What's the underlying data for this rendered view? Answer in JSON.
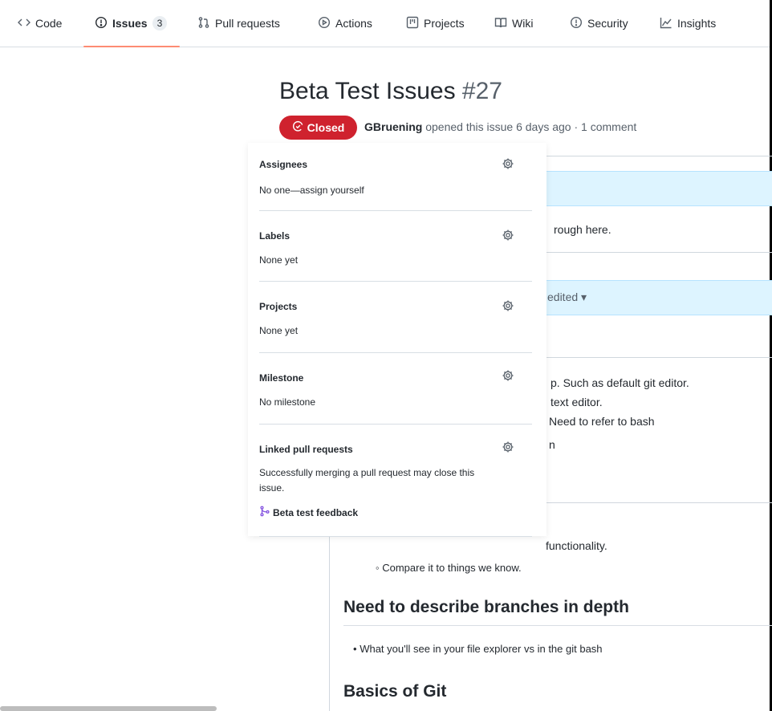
{
  "nav": {
    "tabs": [
      {
        "label": "Code",
        "icon": "code-icon"
      },
      {
        "label": "Issues",
        "icon": "issue-opened-icon",
        "count": "3",
        "active": true
      },
      {
        "label": "Pull requests",
        "icon": "git-pull-request-icon"
      },
      {
        "label": "Actions",
        "icon": "play-icon"
      },
      {
        "label": "Projects",
        "icon": "table-icon"
      },
      {
        "label": "Wiki",
        "icon": "book-icon"
      },
      {
        "label": "Security",
        "icon": "shield-icon"
      },
      {
        "label": "Insights",
        "icon": "graph-icon"
      }
    ]
  },
  "issue": {
    "title": "Beta Test Issues",
    "number": "#27",
    "state": "Closed",
    "state_color": "#cf222e",
    "author": "GBruening",
    "meta": "opened this issue 6 days ago · 1 comment"
  },
  "sidebar": {
    "assignees": {
      "title": "Assignees",
      "value": "No one—assign yourself"
    },
    "labels": {
      "title": "Labels",
      "value": "None yet"
    },
    "projects": {
      "title": "Projects",
      "value": "None yet"
    },
    "milestone": {
      "title": "Milestone",
      "value": "No milestone"
    },
    "linked_prs": {
      "title": "Linked pull requests",
      "value_line1": "Successfully merging a pull request may close this",
      "value_line2": "issue.",
      "pr": "Beta test feedback"
    }
  },
  "body": {
    "fragment1": "rough here.",
    "fragment2": "edited",
    "fragment3": "p. Such as default git editor.",
    "fragment4": "text editor.",
    "fragment5": "Need to refer to bash",
    "fragment6": "n",
    "fragment7": "functionality.",
    "bullet_compare": "Compare it to things we know.",
    "heading_branches": "Need to describe branches in depth",
    "bullet_explorer": "What you'll see in your file explorer vs in the git bash",
    "heading_basics": "Basics of Git"
  }
}
